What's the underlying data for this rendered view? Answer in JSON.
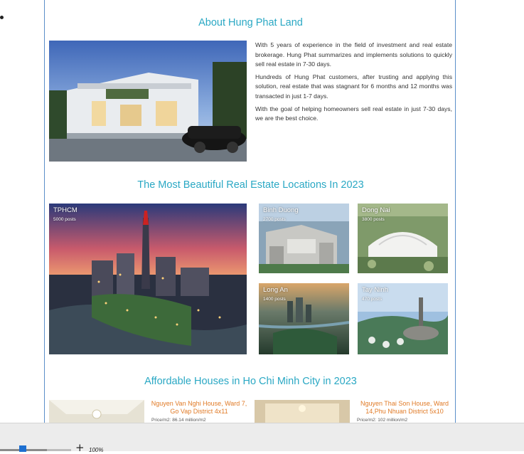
{
  "about": {
    "title": "About Hung Phat Land",
    "paragraphs": [
      "With 5 years of experience in the field of investment and real estate brokerage. Hung Phat summarizes and implements solutions to quickly sell real estate in 7-30 days.",
      "Hundreds of Hung Phat customers, after trusting and applying this solution, real estate that was stagnant for 6 months and 12 months was transacted in just 1-7 days.",
      "With the goal of helping homeowners sell real estate in just 7-30 days, we are the best choice."
    ]
  },
  "locations": {
    "title": "The Most Beautiful Real Estate Locations In 2023",
    "items": [
      {
        "name": "TPHCM",
        "posts": "5000 posts"
      },
      {
        "name": "Binh Duong",
        "posts": "2700 posts"
      },
      {
        "name": "Dong Nai",
        "posts": "3800 posts"
      },
      {
        "name": "Long An",
        "posts": "1400 posts"
      },
      {
        "name": "Tay Ninh",
        "posts": "470 posts"
      }
    ]
  },
  "houses": {
    "title": "Affordable Houses in Ho Chi Minh City in 2023",
    "items": [
      {
        "title": "Nguyen Van Nghi House, Ward 7, Go Vap District 4x11",
        "price": "Price/m2: 86.14 million/m2"
      },
      {
        "title": "Nguyen Thai Son House, Ward 14,Phu Nhuan District 5x10",
        "price": "Price/m2: 102 million/m2"
      }
    ]
  },
  "zoom": {
    "plus": "+",
    "level": "100%",
    "value_fraction": 0.3
  }
}
